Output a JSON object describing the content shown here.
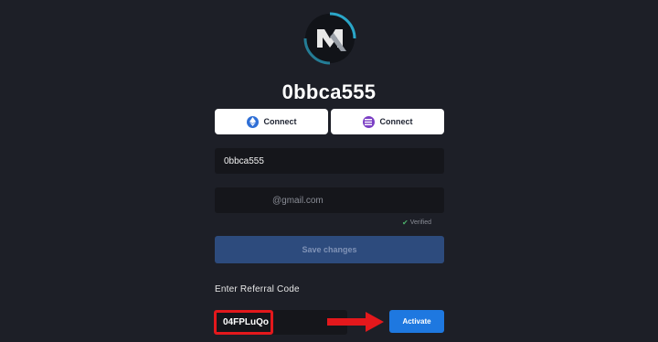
{
  "profile": {
    "username": "0bbca555"
  },
  "connect": {
    "ethereum_label": "Connect",
    "solana_label": "Connect",
    "ethereum_icon": "ethereum-icon",
    "solana_icon": "solana-icon"
  },
  "form": {
    "username_value": "0bbca555",
    "email_value": "@gmail.com",
    "email_status": "Verified",
    "save_label": "Save changes"
  },
  "referral": {
    "label": "Enter Referral Code",
    "code_value": "04FPLuQo",
    "activate_label": "Activate"
  },
  "colors": {
    "background": "#1d1f27",
    "accent": "#1e78e0",
    "annotation": "#e3181c"
  }
}
